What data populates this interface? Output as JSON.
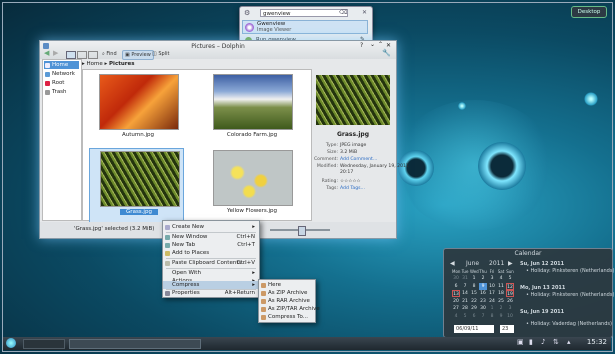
{
  "desktop": {
    "button_label": "Desktop"
  },
  "krunner": {
    "query": "gwenview",
    "results": [
      {
        "title": "Gwenview",
        "subtitle": "Image Viewer"
      },
      {
        "title": "Run gwenview"
      }
    ]
  },
  "dolphin": {
    "title": "Pictures – Dolphin",
    "toolbar": {
      "find": "Find",
      "preview": "Preview",
      "split": "Split"
    },
    "sidebar": [
      "Home",
      "Network",
      "Root",
      "Trash"
    ],
    "breadcrumb": [
      "Home",
      "Pictures"
    ],
    "files": [
      "Autumn.jpg",
      "Colorado Farm.jpg",
      "Grass.jpg",
      "Yellow Flowers.jpg"
    ],
    "selected": "Grass.jpg",
    "info": {
      "filename": "Grass.jpg",
      "rows": [
        {
          "k": "Type:",
          "v": "JPEG image"
        },
        {
          "k": "Size:",
          "v": "3.2 MiB"
        },
        {
          "k": "Comment:",
          "v": "Add Comment..."
        },
        {
          "k": "Modified:",
          "v": "Wednesday, January 19, 2011"
        },
        {
          "k": "",
          "v": "20:17"
        },
        {
          "k": "Rating:",
          "v": "☆☆☆☆☆"
        },
        {
          "k": "Tags:",
          "v": "Add Tags..."
        }
      ]
    },
    "status": "'Grass.jpg' selected (3.2 MiB)"
  },
  "context_menu": {
    "items": [
      {
        "label": "Create New",
        "shortcut": "▸"
      },
      {
        "label": "New Window",
        "shortcut": "Ctrl+N"
      },
      {
        "label": "New Tab",
        "shortcut": "Ctrl+T"
      },
      {
        "label": "Add to Places",
        "shortcut": ""
      },
      {
        "label": "Paste Clipboard Contents...",
        "shortcut": "Ctrl+V"
      },
      {
        "label": "Open With",
        "shortcut": "▸"
      },
      {
        "label": "Actions",
        "shortcut": "▸"
      },
      {
        "label": "Compress",
        "shortcut": "▸"
      },
      {
        "label": "Properties",
        "shortcut": "Alt+Return"
      }
    ]
  },
  "compress_menu": {
    "items": [
      "Here",
      "As ZIP Archive",
      "As RAR Archive",
      "As ZIP/TAR Archive",
      "Compress To..."
    ]
  },
  "calendar": {
    "title": "Calendar",
    "month": "June",
    "year": "2011",
    "weekdays": [
      "Mon",
      "Tue",
      "Wed",
      "Thu",
      "Fri",
      "Sat",
      "Sun"
    ],
    "weeks": [
      [
        "30",
        "31",
        "1",
        "2",
        "3",
        "4",
        "5"
      ],
      [
        "6",
        "7",
        "8",
        "9",
        "10",
        "11",
        "12"
      ],
      [
        "13",
        "14",
        "15",
        "16",
        "17",
        "18",
        "19"
      ],
      [
        "20",
        "21",
        "22",
        "23",
        "24",
        "25",
        "26"
      ],
      [
        "27",
        "28",
        "29",
        "30",
        "1",
        "2",
        "3"
      ],
      [
        "4",
        "5",
        "6",
        "7",
        "8",
        "9",
        "10"
      ]
    ],
    "date_input": "06/09/11",
    "week_input": "23",
    "events": [
      {
        "day": "Su, Jun 12 2011",
        "item": "• Holiday: Pinksteren (Netherlands)"
      },
      {
        "day": "Mo, Jun 13 2011",
        "item": "• Holiday: Pinksteren (Netherlands)"
      },
      {
        "day": "Su, Jun 19 2011",
        "item": "• Holiday: Vaderdag (Netherlands)"
      }
    ]
  },
  "taskbar": {
    "clock": "15:32"
  }
}
